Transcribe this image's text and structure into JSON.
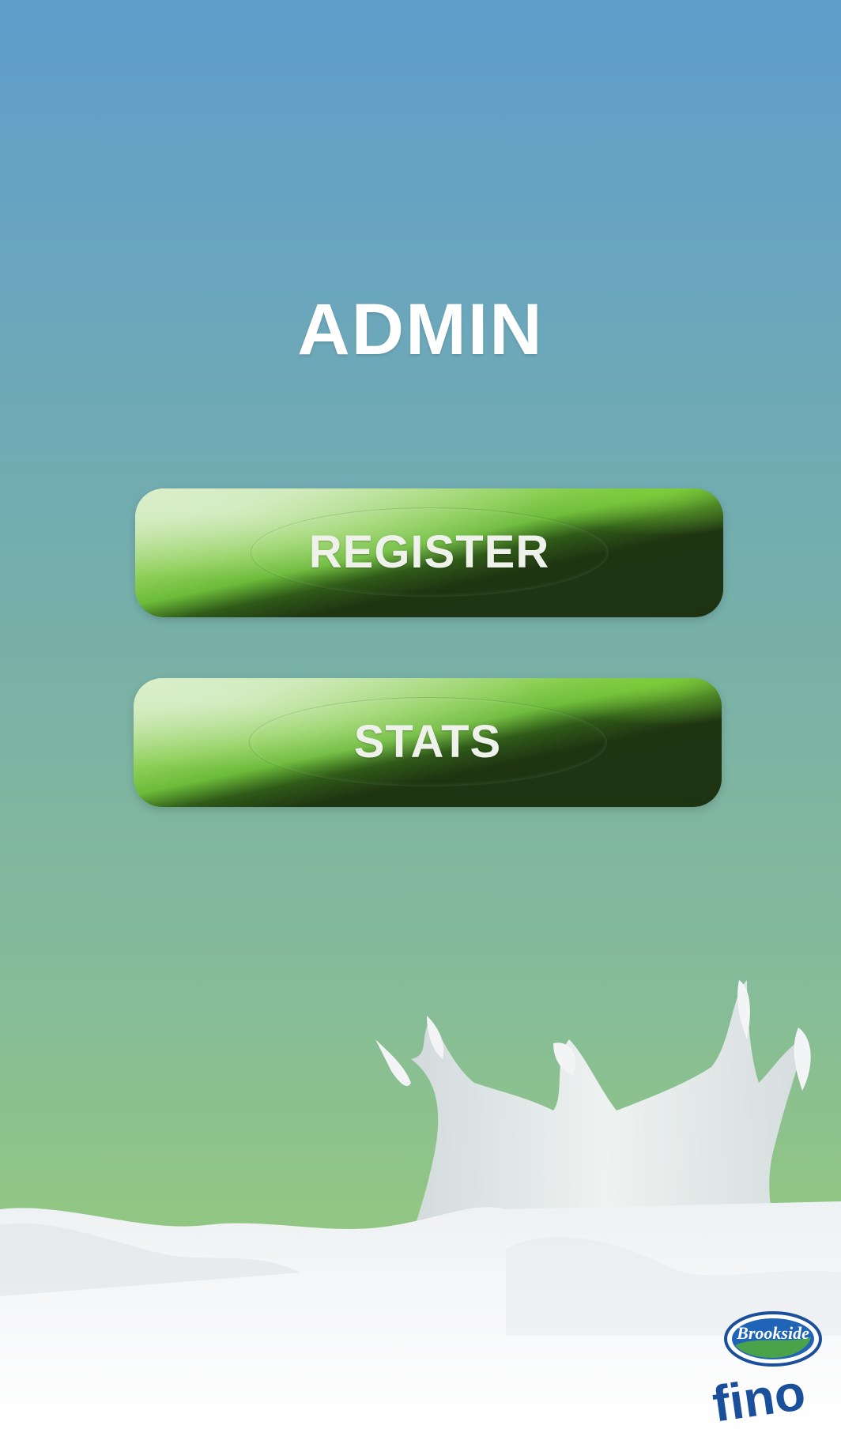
{
  "screen": {
    "title": "ADMIN"
  },
  "buttons": {
    "register_label": "REGISTER",
    "stats_label": "STATS"
  },
  "logo": {
    "brand": "Brookside",
    "product": "fino"
  },
  "colors": {
    "background_top": "#5e9dcc",
    "background_bottom": "#98c87e",
    "button_light": "#c3e4a8",
    "button_dark": "#1f3512",
    "logo_blue": "#1a4f9c"
  }
}
